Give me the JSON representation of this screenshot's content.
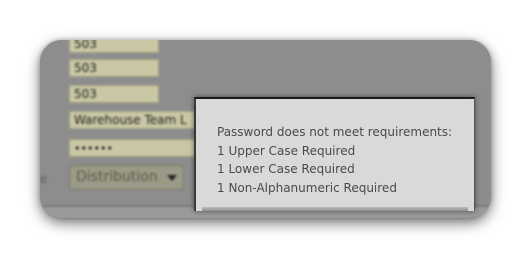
{
  "form": {
    "fields": [
      {
        "value": "503"
      },
      {
        "value": "503"
      },
      {
        "value": "503"
      },
      {
        "value": "Warehouse Team L"
      },
      {
        "value": "••••••"
      }
    ],
    "side_label": "e",
    "role_select": {
      "value": "Distribution"
    }
  },
  "tooltip": {
    "title": "Password does not meet requirements:",
    "requirements": [
      "1 Upper Case Required",
      "1 Lower Case Required",
      "1 Non-Alphanumeric Required"
    ]
  }
}
